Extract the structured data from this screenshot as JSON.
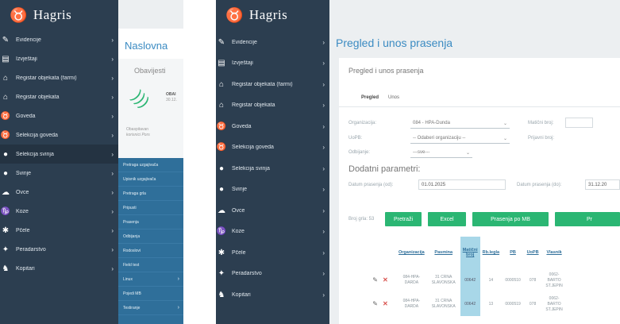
{
  "left_panel": {
    "logo_text": "Hagris",
    "nav": [
      {
        "label": "Evidencije",
        "icon": "edit-icon"
      },
      {
        "label": "Izvještaji",
        "icon": "report-icon"
      },
      {
        "label": "Registar objekata (farmi)",
        "icon": "farm-icon"
      },
      {
        "label": "Registar objekata",
        "icon": "building-icon"
      },
      {
        "label": "Goveda",
        "icon": "cattle-icon"
      },
      {
        "label": "Selekcija goveda",
        "icon": "cattle-selection-icon"
      },
      {
        "label": "Selekcija svinja",
        "icon": "pig-selection-icon"
      },
      {
        "label": "Svinje",
        "icon": "pig-icon"
      },
      {
        "label": "Ovce",
        "icon": "sheep-icon"
      },
      {
        "label": "Koze",
        "icon": "goat-icon"
      },
      {
        "label": "Pčele",
        "icon": "bee-icon"
      },
      {
        "label": "Peradarstvo",
        "icon": "poultry-icon"
      },
      {
        "label": "Kopitari",
        "icon": "horse-icon"
      }
    ],
    "page_title": "Naslovna",
    "notices_title": "Obavijesti",
    "notice_title_fragment": "OBAI",
    "notice_date_fragment": "30.12.",
    "notice_text_1": "Obaspitavan",
    "notice_text_2": "korisnici Pors",
    "submenu": [
      {
        "label": "Pretraga uzgajivača",
        "has_arrow": false
      },
      {
        "label": "Upisnik uzgajivača",
        "has_arrow": false
      },
      {
        "label": "Pretraga grla",
        "has_arrow": false
      },
      {
        "label": "Pripusti",
        "has_arrow": false
      },
      {
        "label": "Prasenja",
        "has_arrow": false
      },
      {
        "label": "Odbijanja",
        "has_arrow": false
      },
      {
        "label": "Rodoslovi",
        "has_arrow": false
      },
      {
        "label": "Field test",
        "has_arrow": false
      },
      {
        "label": "Linux",
        "has_arrow": true
      },
      {
        "label": "Pojedi MB",
        "has_arrow": false
      },
      {
        "label": "Testiranje",
        "has_arrow": true
      }
    ]
  },
  "right_panel": {
    "logo_text": "Hagris",
    "page_title": "Pregled i unos prasenja",
    "card_title": "Pregled i unos prasenja",
    "tabs": [
      "Pregled",
      "Unos"
    ],
    "organizacija_label": "Organizacija:",
    "organizacija_value": "084 - HPA-Dunda",
    "maticni_broj_label": "Matični broj:",
    "uopb_label": "UoPB:",
    "uopb_value": "-- Odaberi organizaciju --",
    "prijavni_broj_label": "Prijavni broj:",
    "odbijanje_label": "Odbijanje:",
    "odbijanje_value": "---sve---",
    "extra_params_title": "Dodatni parametri:",
    "datum_od_label": "Datum prasenja (od):",
    "datum_od_value": "01.01.2025",
    "datum_do_label": "Datum prasenja (do):",
    "datum_do_value": "31.12.20",
    "count_label": "Broj grla: 53",
    "buttons": [
      "Pretraži",
      "Excel",
      "Prasenja po MB",
      "Pr"
    ],
    "table_headers": [
      "Organizacija",
      "Pasmina",
      "Matični broj",
      "Rb.legla",
      "PB",
      "UoPB",
      "Vlasnik"
    ],
    "rows": [
      [
        "084-HPA-DARDA",
        "31 CRNA SLAVONSKA",
        "00642",
        "14",
        "0000510",
        "078",
        "0062-BARTO ST.JEPIN"
      ],
      [
        "084-HPA-DARDA",
        "31 CRNA SLAVONSKA",
        "00642",
        "13",
        "0000519",
        "078",
        "0062-BARTO ST.JEPIN"
      ]
    ]
  },
  "colors": {
    "sidebar": "#2c3e50",
    "submenu": "#2f6f9a",
    "accent_green": "#2bb673",
    "title_blue": "#3b8bc2",
    "highlight_cell": "#a8d7e8"
  }
}
